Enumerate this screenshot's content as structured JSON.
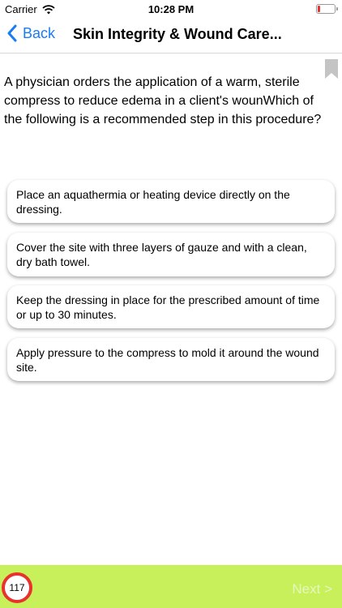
{
  "status": {
    "carrier": "Carrier",
    "time": "10:28 PM"
  },
  "nav": {
    "back_label": "Back",
    "title": "Skin Integrity & Wound Care..."
  },
  "question": "A physician orders the application of a warm, sterile compress to reduce edema in a client's wounWhich of the following is a recommended step in this procedure?",
  "options": [
    {
      "text": "Place an aquathermia or heating device directly on the dressing."
    },
    {
      "text": "Cover the site with three layers of gauze and with a clean, dry bath towel."
    },
    {
      "text": "Keep the dressing in place for the prescribed amount of time or up to 30 minutes."
    },
    {
      "text": "Apply pressure to the compress to mold it around the wound site."
    }
  ],
  "footer": {
    "counter": "117",
    "next_label": "Next >"
  },
  "colors": {
    "accent": "#1a7cf5",
    "footer_bg": "#c8f05a",
    "counter_ring": "#e8322d"
  },
  "icons": [
    "wifi-icon",
    "battery-icon",
    "chevron-left-icon",
    "bookmark-icon"
  ]
}
